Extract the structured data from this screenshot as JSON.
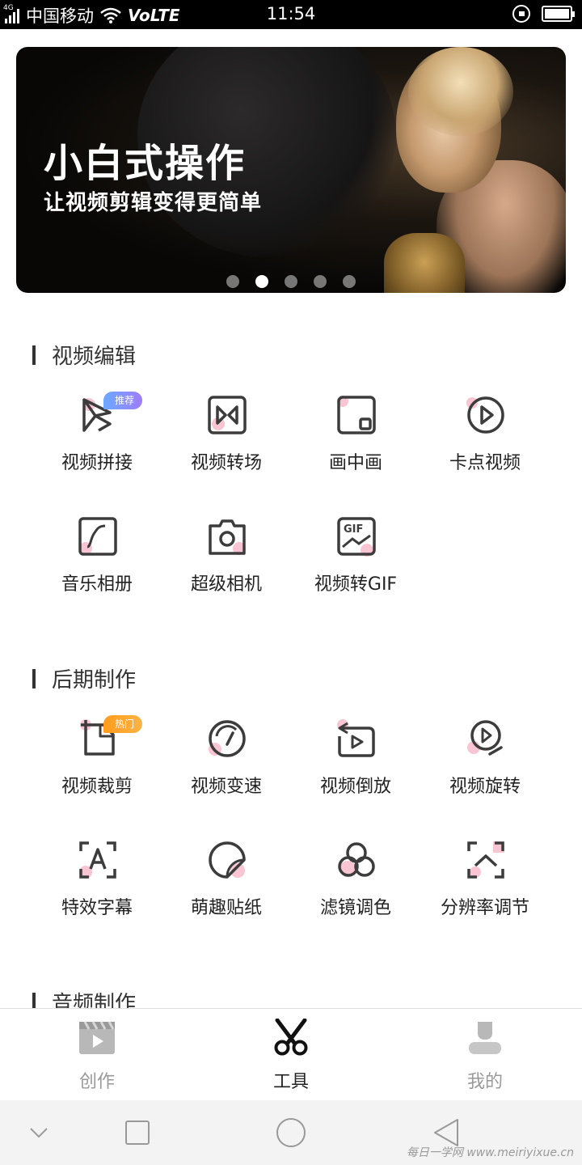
{
  "status_bar": {
    "network_tag": "4G",
    "carrier": "中国移动",
    "volte": "VoLTE",
    "time": "11:54"
  },
  "banner": {
    "title": "小白式操作",
    "subtitle": "让视频剪辑变得更简单",
    "page_count": 5,
    "active_page": 1
  },
  "sections": [
    {
      "title": "视频编辑",
      "items": [
        {
          "label": "视频拼接",
          "icon": "splice-play-icon",
          "badge": "推荐"
        },
        {
          "label": "视频转场",
          "icon": "transition-icon"
        },
        {
          "label": "画中画",
          "icon": "picture-in-picture-icon"
        },
        {
          "label": "卡点视频",
          "icon": "beat-video-icon"
        },
        {
          "label": "音乐相册",
          "icon": "music-album-icon"
        },
        {
          "label": "超级相机",
          "icon": "camera-icon"
        },
        {
          "label": "视频转GIF",
          "icon": "gif-icon"
        }
      ]
    },
    {
      "title": "后期制作",
      "items": [
        {
          "label": "视频裁剪",
          "icon": "crop-icon",
          "badge": "热门"
        },
        {
          "label": "视频变速",
          "icon": "speed-gauge-icon"
        },
        {
          "label": "视频倒放",
          "icon": "reverse-play-icon"
        },
        {
          "label": "视频旋转",
          "icon": "rotate-play-icon"
        },
        {
          "label": "特效字幕",
          "icon": "subtitle-icon"
        },
        {
          "label": "萌趣贴纸",
          "icon": "sticker-icon"
        },
        {
          "label": "滤镜调色",
          "icon": "filter-icon"
        },
        {
          "label": "分辨率调节",
          "icon": "resolution-icon"
        }
      ]
    },
    {
      "title": "音频制作",
      "items": []
    }
  ],
  "bottom_nav": [
    {
      "label": "创作",
      "icon": "clapperboard-icon",
      "active": false
    },
    {
      "label": "工具",
      "icon": "scissors-icon",
      "active": true
    },
    {
      "label": "我的",
      "icon": "profile-icon",
      "active": false
    }
  ],
  "watermark": "每日一学网 www.meiriyixue.cn",
  "colors": {
    "accent_pink": "#f7b6c8",
    "icon_stroke": "#3c3c3c",
    "nav_active": "#222222",
    "nav_inactive": "#999999",
    "badge_blue": "#7c8cff",
    "badge_orange": "#ff9c1a"
  }
}
